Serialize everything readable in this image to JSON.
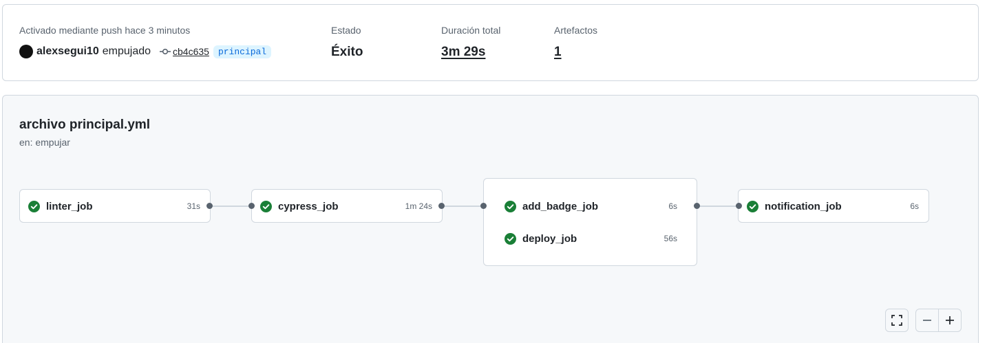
{
  "summary": {
    "trigger_label": "Activado mediante push hace 3 minutos",
    "username": "alexsegui10",
    "action": "empujado",
    "commit_sha": "cb4c635",
    "branch": "principal",
    "status_label": "Estado",
    "status_value": "Éxito",
    "duration_label": "Duración total",
    "duration_value": "3m 29s",
    "artifacts_label": "Artefactos",
    "artifacts_value": "1"
  },
  "workflow": {
    "title": "archivo principal.yml",
    "trigger": "en: empujar",
    "jobs": [
      {
        "name": "linter_job",
        "duration": "31s",
        "status": "success"
      },
      {
        "name": "cypress_job",
        "duration": "1m 24s",
        "status": "success"
      },
      {
        "name": "add_badge_job",
        "duration": "6s",
        "status": "success"
      },
      {
        "name": "deploy_job",
        "duration": "56s",
        "status": "success"
      },
      {
        "name": "notification_job",
        "duration": "6s",
        "status": "success"
      }
    ]
  },
  "controls": {
    "fullscreen_icon": "fullscreen-icon",
    "zoom_out_icon": "minus-icon",
    "zoom_in_icon": "plus-icon"
  },
  "colors": {
    "success": "#1a7f37",
    "branch_text": "#0969da",
    "branch_bg": "#ddf4ff",
    "panel_bg": "#f6f8fa"
  }
}
